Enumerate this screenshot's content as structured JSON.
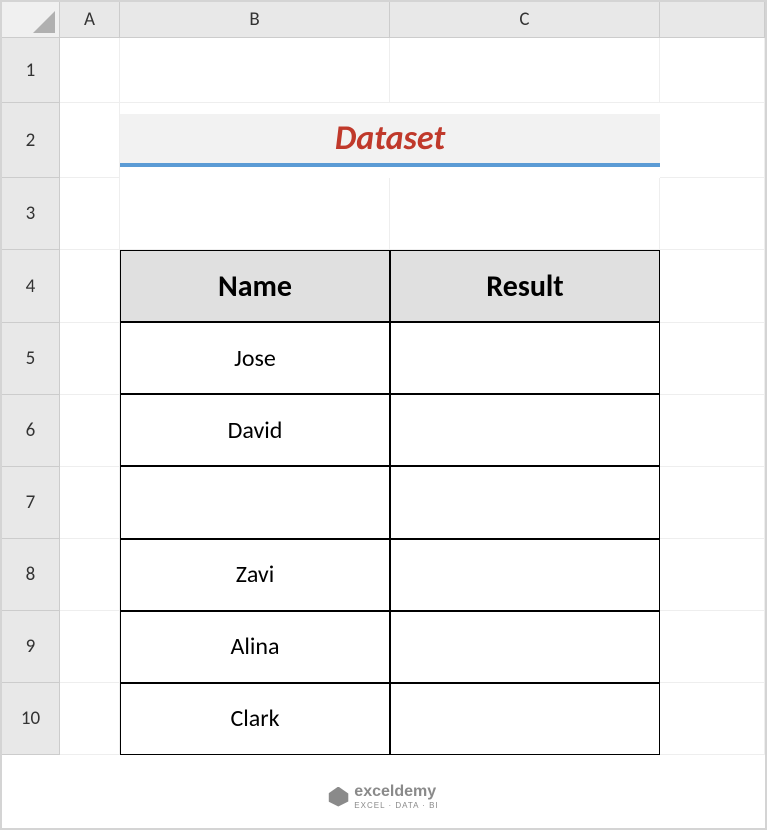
{
  "columns": [
    "A",
    "B",
    "C"
  ],
  "rows": [
    "1",
    "2",
    "3",
    "4",
    "5",
    "6",
    "7",
    "8",
    "9",
    "10"
  ],
  "title": "Dataset",
  "table": {
    "headers": [
      "Name",
      "Result"
    ],
    "data": [
      {
        "name": "Jose",
        "result": ""
      },
      {
        "name": "David",
        "result": ""
      },
      {
        "name": "",
        "result": ""
      },
      {
        "name": "Zavi",
        "result": ""
      },
      {
        "name": "Alina",
        "result": ""
      },
      {
        "name": "Clark",
        "result": ""
      }
    ]
  },
  "watermark": {
    "brand": "exceldemy",
    "tagline": "EXCEL · DATA · BI"
  }
}
